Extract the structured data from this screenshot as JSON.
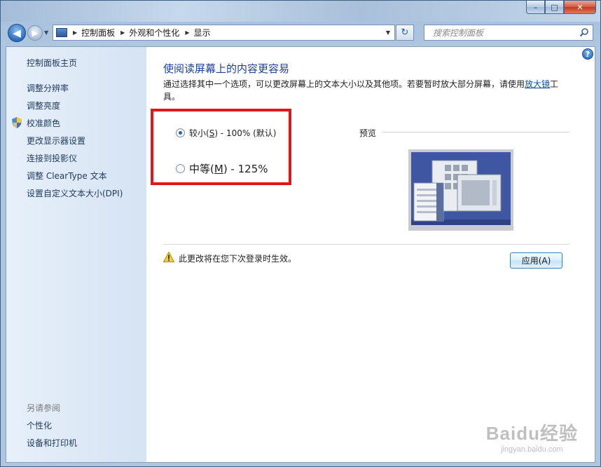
{
  "navigation": {
    "breadcrumbs": [
      "控制面板",
      "外观和个性化",
      "显示"
    ],
    "search_placeholder": "搜索控制面板"
  },
  "window_controls": {
    "minimize": "–",
    "maximize": "□",
    "close": "✕"
  },
  "sidebar": {
    "home": "控制面板主页",
    "links": [
      "调整分辨率",
      "调整亮度",
      "校准颜色",
      "更改显示器设置",
      "连接到投影仪",
      "调整 ClearType 文本",
      "设置自定义文本大小(DPI)"
    ],
    "see_also_title": "另请参阅",
    "see_also": [
      "个性化",
      "设备和打印机"
    ]
  },
  "main": {
    "heading": "使阅读屏幕上的内容更容易",
    "description": "通过选择其中一个选项，可以更改屏幕上的文本大小以及其他项。若要暂时放大部分屏幕，请使用",
    "magnifier_link": "放大镜",
    "description_end": "工具。",
    "options": [
      {
        "prefix": "较小(",
        "key": "S",
        "suffix": ") - 100% (默认)",
        "selected": true
      },
      {
        "prefix": "中等(",
        "key": "M",
        "suffix": ") - 125%",
        "selected": false
      }
    ],
    "preview_label": "预览",
    "warning": "此更改将在您下次登录时生效。",
    "apply_button": "应用(A)"
  },
  "watermark": {
    "logo": "Baidu经验",
    "sub": "jingyan.baidu.com"
  },
  "colors": {
    "highlight": "#e0161b",
    "link": "#0b4ea2",
    "heading": "#1e3f96"
  }
}
